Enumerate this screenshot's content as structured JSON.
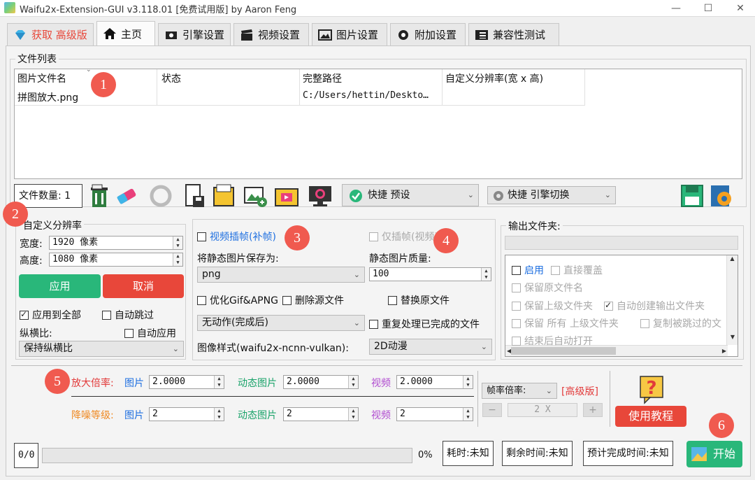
{
  "window": {
    "title": "Waifu2x-Extension-GUI v3.118.01 [免费试用版] by Aaron Feng",
    "min": "—",
    "max": "☐",
    "close": "✕"
  },
  "tabs": [
    {
      "label": "获取 高级版",
      "icon": "diamond-icon"
    },
    {
      "label": "主页",
      "icon": "home-icon"
    },
    {
      "label": "引擎设置",
      "icon": "engine-icon"
    },
    {
      "label": "视频设置",
      "icon": "clapperboard-icon"
    },
    {
      "label": "图片设置",
      "icon": "image-icon"
    },
    {
      "label": "附加设置",
      "icon": "settings-icon"
    },
    {
      "label": "兼容性测试",
      "icon": "checklist-icon"
    }
  ],
  "filelist": {
    "title": "文件列表",
    "columns": [
      "图片文件名",
      "状态",
      "完整路径",
      "自定义分辨率(宽 x 高)"
    ],
    "rows": [
      {
        "name": "拼图放大.png",
        "status": "",
        "path": "C:/Users/hettin/Deskto…",
        "res": ""
      }
    ]
  },
  "toolbar": {
    "file_count": "文件数量: 1",
    "preset": "快捷 预设",
    "engine_switch": "快捷 引擎切换"
  },
  "custom_res": {
    "title": "自定义分辨率",
    "width_label": "宽度:",
    "width_value": "1920 像素",
    "height_label": "高度:",
    "height_value": "1080 像素",
    "apply": "应用",
    "cancel": "取消",
    "apply_all": "应用到全部",
    "auto_skip": "自动跳过",
    "aspect_label": "纵横比:",
    "auto_apply": "自动应用",
    "aspect_value": "保持纵横比"
  },
  "mid": {
    "video_interp": "视频插帧(补帧)",
    "interp_only": "仅插帧(视频)",
    "save_static_as": "将静态图片保存为:",
    "format": "png",
    "quality_label": "静态图片质量:",
    "quality": "100",
    "opt_gif": "优化Gif&APNG",
    "delete_src": "删除源文件",
    "replace_orig": "替换原文件",
    "after_action": "无动作(完成后)",
    "reprocess": "重复处理已完成的文件",
    "style_label": "图像样式(waifu2x-ncnn-vulkan):",
    "style_value": "2D动漫"
  },
  "output": {
    "title": "输出文件夹:",
    "path": "",
    "enable": "启用",
    "overwrite": "直接覆盖",
    "keep_name": "保留原文件名",
    "keep_parent": "保留上级文件夹",
    "auto_create": "自动创建输出文件夹",
    "keep_all_parent": "保留 所有 上级文件夹",
    "copy_skipped": "复制被跳过的文",
    "open_after": "结束后自动打开"
  },
  "scale": {
    "label": "放大倍率:",
    "image": "图片",
    "image_val": "2.0000",
    "anim": "动态图片",
    "anim_val": "2.0000",
    "video": "视频",
    "video_val": "2.0000"
  },
  "denoise": {
    "label": "降噪等级:",
    "image": "图片",
    "image_val": "2",
    "anim": "动态图片",
    "anim_val": "2",
    "video": "视频",
    "video_val": "2"
  },
  "frame": {
    "label": "帧率倍率:",
    "pro": "[高级版]",
    "minus": "−",
    "value": "2 X",
    "plus": "+"
  },
  "help": {
    "label": "使用教程"
  },
  "status": {
    "count": "0/0",
    "progress_percent": 0,
    "percent_text": "0%",
    "elapsed": "耗时:未知",
    "remaining": "剩余时间:未知",
    "eta": "预计完成时间:未知",
    "start": "开始"
  },
  "badges": [
    "1",
    "2",
    "3",
    "4",
    "5",
    "6"
  ],
  "colors": {
    "accent_green": "#29b77a",
    "cancel_red": "#e8473a",
    "blue_text": "#1e6fe0",
    "green_text": "#1aa36a",
    "purple_text": "#b04bd0",
    "orange_text": "#ef8a23",
    "pro_red": "#e23a3a",
    "badge": "#f05a4f"
  }
}
